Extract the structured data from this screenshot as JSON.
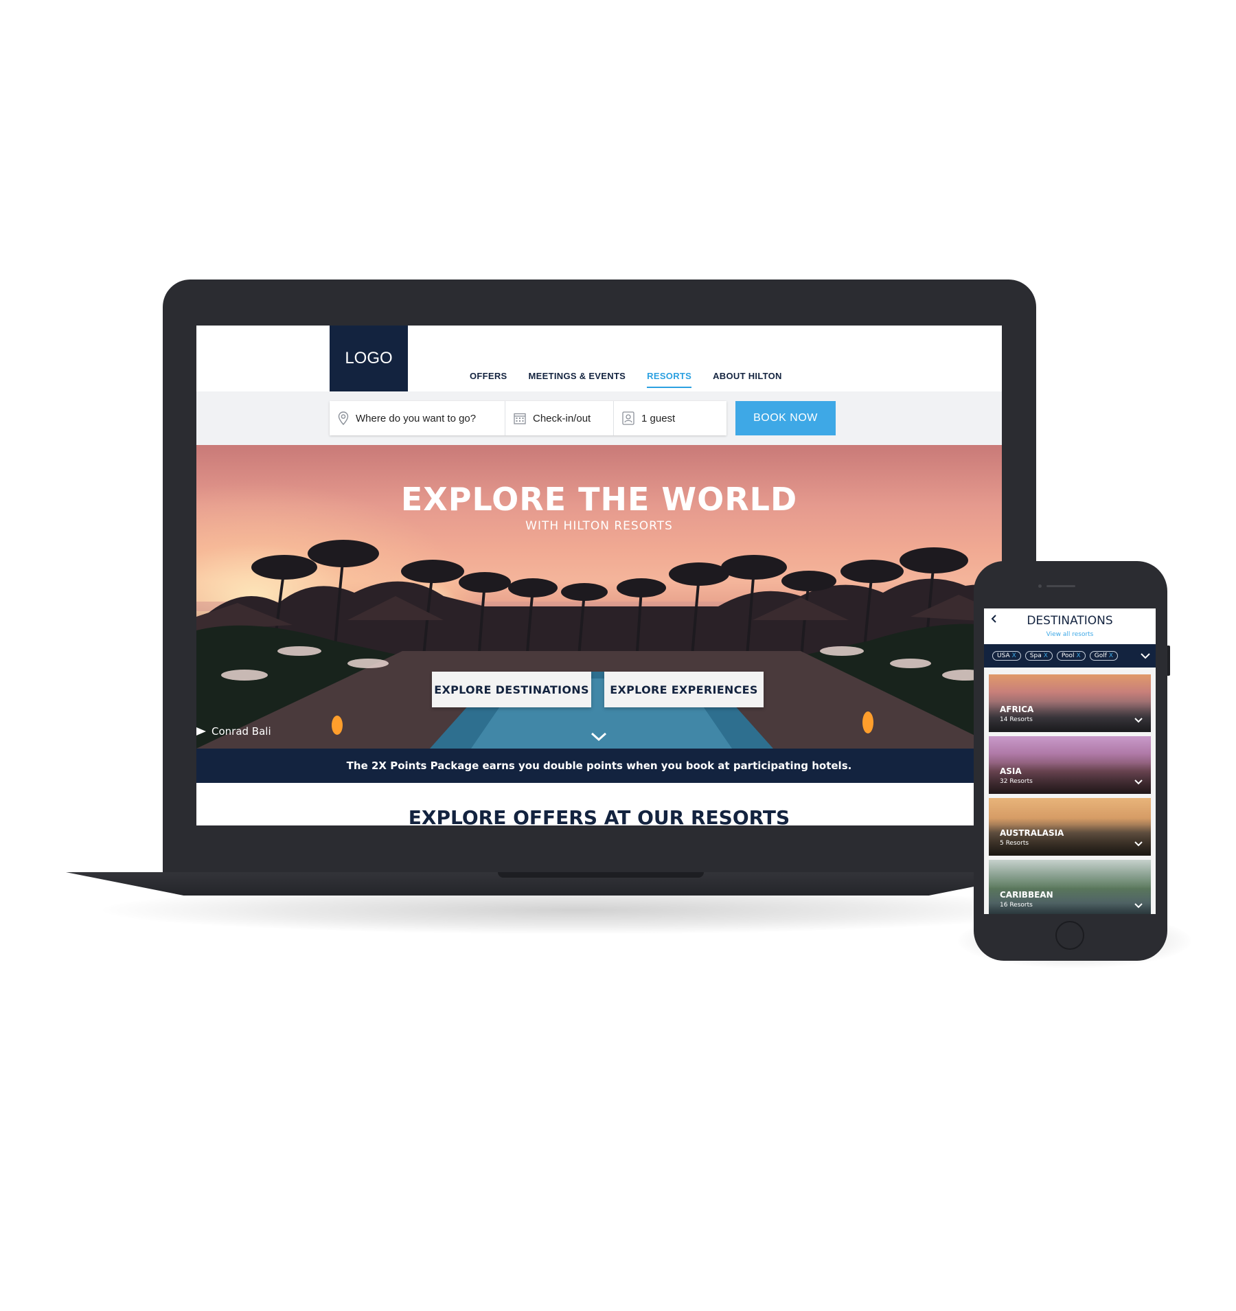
{
  "desktop": {
    "logo": "LOGO",
    "nav": [
      {
        "label": "OFFERS",
        "active": false
      },
      {
        "label": "MEETINGS & EVENTS",
        "active": false
      },
      {
        "label": "RESORTS",
        "active": true
      },
      {
        "label": "ABOUT HILTON",
        "active": false
      }
    ],
    "booking": {
      "destination_placeholder": "Where do you want to go?",
      "dates_label": "Check-in/out",
      "guests_value": "1 guest",
      "book_button": "BOOK NOW"
    },
    "hero": {
      "title": "EXPLORE THE WORLD",
      "subtitle": "WITH HILTON RESORTS",
      "button_destinations": "EXPLORE DESTINATIONS",
      "button_experiences": "EXPLORE EXPERIENCES",
      "photo_caption": "Conrad Bali"
    },
    "promo_text": "The 2X Points Package earns you double points when you book at participating hotels.",
    "offers_heading": "EXPLORE OFFERS AT OUR RESORTS"
  },
  "mobile": {
    "title": "DESTINATIONS",
    "view_all": "View all resorts",
    "filters": [
      {
        "label": "USA",
        "remove": "X"
      },
      {
        "label": "Spa",
        "remove": "X"
      },
      {
        "label": "Pool",
        "remove": "X"
      },
      {
        "label": "Golf",
        "remove": "X"
      }
    ],
    "destinations": [
      {
        "name": "AFRICA",
        "count": "14 Resorts"
      },
      {
        "name": "ASIA",
        "count": "32 Resorts"
      },
      {
        "name": "AUSTRALASIA",
        "count": "5 Resorts"
      },
      {
        "name": "CARIBBEAN",
        "count": "16 Resorts"
      }
    ]
  },
  "colors": {
    "navy": "#13233f",
    "accent_blue": "#3ea8e6",
    "device_frame": "#2b2c31"
  },
  "icons": [
    "location-pin-icon",
    "calendar-icon",
    "guest-icon",
    "chevron-down-icon",
    "play-triangle-icon",
    "back-arrow-icon"
  ]
}
